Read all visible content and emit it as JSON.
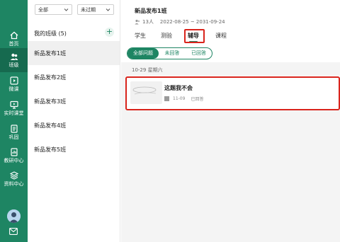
{
  "rail": {
    "items": [
      {
        "label": "首页",
        "icon": "home-icon"
      },
      {
        "label": "班级",
        "icon": "class-group-icon"
      },
      {
        "label": "微课",
        "icon": "microlesson-icon"
      },
      {
        "label": "实时课堂",
        "icon": "live-class-icon"
      },
      {
        "label": "巩固",
        "icon": "consolidate-icon"
      },
      {
        "label": "教研中心",
        "icon": "research-center-icon"
      },
      {
        "label": "资料中心",
        "icon": "resource-center-icon"
      }
    ],
    "active_index": 1,
    "colors": {
      "background": "#1e8563",
      "active": "#166a4f"
    }
  },
  "classpanel": {
    "filter_scope": "全部",
    "filter_status": "未过期",
    "list_title": "我的班级 (5)",
    "add_label": "+",
    "classes": [
      "新品发布1班",
      "新品发布2班",
      "新品发布3班",
      "新品发布4班",
      "新品发布5班"
    ],
    "active_index": 0
  },
  "main": {
    "title": "新品发布1班",
    "student_count": "13人",
    "date_range": "2022-08-25 ~ 2031-09-24",
    "tabs": [
      "学生",
      "测验",
      "辅导",
      "课程"
    ],
    "active_tab": "辅导",
    "filters": [
      "全部问题",
      "未回答",
      "已回答"
    ],
    "active_filter": "全部问题",
    "date_header": "10-29  星期六",
    "questions": [
      {
        "title": "这题我不会",
        "date": "11-09",
        "status": "已回答"
      }
    ],
    "accent_color": "#1e8563",
    "highlight_color": "#d9241c"
  }
}
